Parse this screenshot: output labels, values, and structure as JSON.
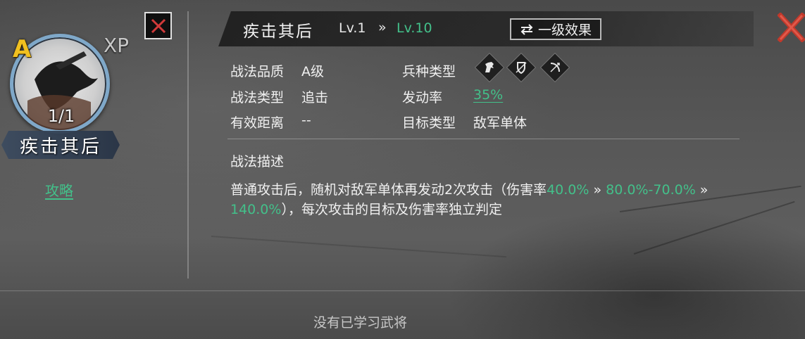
{
  "hero": {
    "grade": "A",
    "xp_label": "XP",
    "count": "1/1",
    "name": "疾击其后",
    "strategy_link": "攻略"
  },
  "header": {
    "tactic_name": "疾击其后",
    "level_current": "Lv.1",
    "level_arrow": "»",
    "level_max": "Lv.10",
    "effect_button": "一级效果",
    "effect_button_icon": "swap-arrows-icon"
  },
  "info": {
    "quality_label": "战法品质",
    "quality_value": "A级",
    "type_label": "战法类型",
    "type_value": "追击",
    "range_label": "有效距离",
    "range_value": "--",
    "troop_label": "兵种类型",
    "troop_icons": [
      "cavalry-icon",
      "shield-icon",
      "bow-icon"
    ],
    "rate_label": "发动率",
    "rate_value": "35%",
    "target_label": "目标类型",
    "target_value": "敌军单体"
  },
  "description": {
    "title": "战法描述",
    "part1": "普通攻击后，随机对敌军单体再发动2次攻击（伤害率",
    "g1": "40.0%",
    "arrow1": " » ",
    "g2": "80.0%-70.0%",
    "arrow2": " » ",
    "g3": "140.0%",
    "part2": "），每次攻击的目标及伤害率独立判定"
  },
  "footer": {
    "note": "没有已学习武将"
  },
  "colors": {
    "accent_green": "#43c08a",
    "grade_gold": "#f0c020",
    "close_red": "#c0392b",
    "portrait_ring": "#7fa8c9"
  }
}
